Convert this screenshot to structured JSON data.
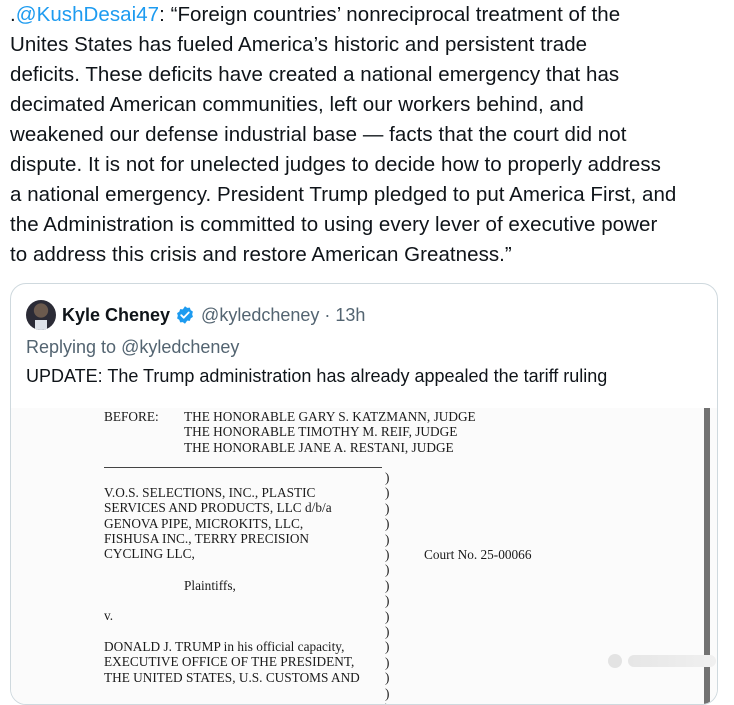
{
  "tweet": {
    "lead": ".",
    "mention": "@KushDesai47",
    "text_line1": ": “Foreign countries’ nonreciprocal treatment of the",
    "lines": [
      "Unites States has fueled America’s historic and persistent trade",
      "deficits. These deficits have created a national emergency that has",
      "decimated American communities, left our workers behind, and",
      "weakened our defense industrial base — facts that the court did not",
      "dispute. It is not for unelected judges to decide how to properly address",
      "a national emergency. President Trump pledged to put America First, and",
      "the Administration is committed to using every lever of executive power",
      "to address this crisis and restore American Greatness.”"
    ]
  },
  "quote": {
    "author_name": "Kyle Cheney",
    "handle": "@kyledcheney",
    "separator": "·",
    "time": "13h",
    "replying_prefix": "Replying to ",
    "replying_handle": "@kyledcheney",
    "body": "UPDATE: The Trump administration has already appealed the tariff ruling",
    "verified_color": "#1d9bf0"
  },
  "document": {
    "before_label": "BEFORE:",
    "judges": [
      "THE HONORABLE GARY S. KATZMANN, JUDGE",
      "THE HONORABLE TIMOTHY M. REIF, JUDGE",
      "THE HONORABLE JANE A. RESTANI, JUDGE"
    ],
    "plaintiffs_lines": [
      "V.O.S. SELECTIONS, INC., PLASTIC",
      "SERVICES AND PRODUCTS, LLC d/b/a",
      "GENOVA PIPE, MICROKITS, LLC,",
      "FISHUSA INC., TERRY PRECISION",
      "CYCLING LLC,"
    ],
    "plaintiffs_label": "Plaintiffs,",
    "versus": "v.",
    "defendants_lines": [
      "DONALD J. TRUMP in his official capacity,",
      "EXECUTIVE OFFICE OF THE PRESIDENT,",
      "THE UNITED STATES, U.S. CUSTOMS AND"
    ],
    "court_no": "Court No. 25-00066"
  }
}
